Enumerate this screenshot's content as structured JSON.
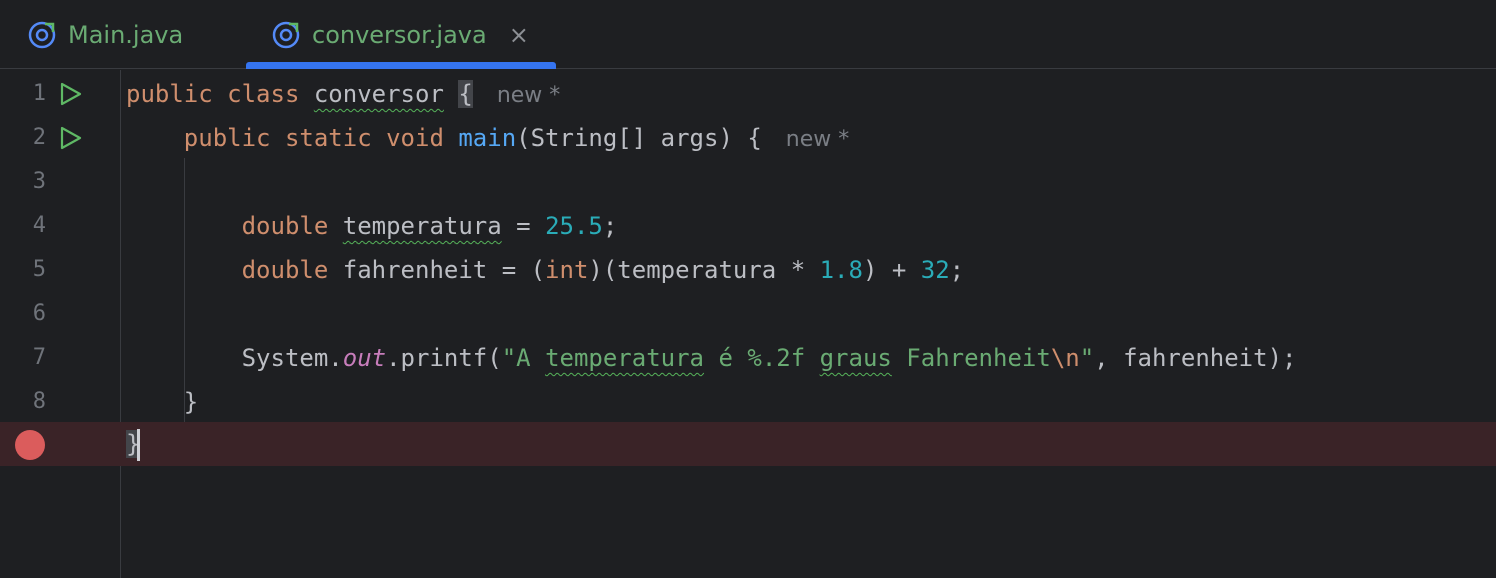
{
  "tabs": [
    {
      "label": "Main.java",
      "active": false,
      "icon": "java-class-icon"
    },
    {
      "label": "conversor.java",
      "active": true,
      "icon": "java-class-icon",
      "close": "×"
    }
  ],
  "editor": {
    "line_numbers": [
      "1",
      "2",
      "3",
      "4",
      "5",
      "6",
      "7",
      "8"
    ],
    "hints": {
      "line1": "new *",
      "line2": "new *"
    },
    "code": {
      "l1_public": "public",
      "l1_class": "class",
      "l1_name": "conversor",
      "l1_brace": "{",
      "l2_public": "public",
      "l2_static": "static",
      "l2_void": "void",
      "l2_main": "main",
      "l2_params": "(String[] args) {",
      "l4_type": "double",
      "l4_var": "temperatura",
      "l4_eq": " = ",
      "l4_num": "25.5",
      "l4_end": ";",
      "l5_type": "double",
      "l5_rest1": " fahrenheit = (",
      "l5_int": "int",
      "l5_rest2": ")(temperatura * ",
      "l5_num1": "1.8",
      "l5_rest3": ") + ",
      "l5_num2": "32",
      "l5_end": ";",
      "l7_sys": "System.",
      "l7_out": "out",
      "l7_printf": ".printf(",
      "l7_str1": "\"A ",
      "l7_str_temp": "temperatura",
      "l7_str2": " é %.2f ",
      "l7_str_graus": "graus",
      "l7_str3": " Fahrenheit",
      "l7_escape": "\\n",
      "l7_str4": "\"",
      "l7_end": ", fahrenheit);",
      "l8": "}",
      "l9": "}"
    }
  },
  "colors": {
    "accent": "#3574f0",
    "keyword": "#cf8e6d",
    "string": "#6aab73",
    "number": "#2aacb8",
    "breakpoint": "#db5c5c"
  }
}
